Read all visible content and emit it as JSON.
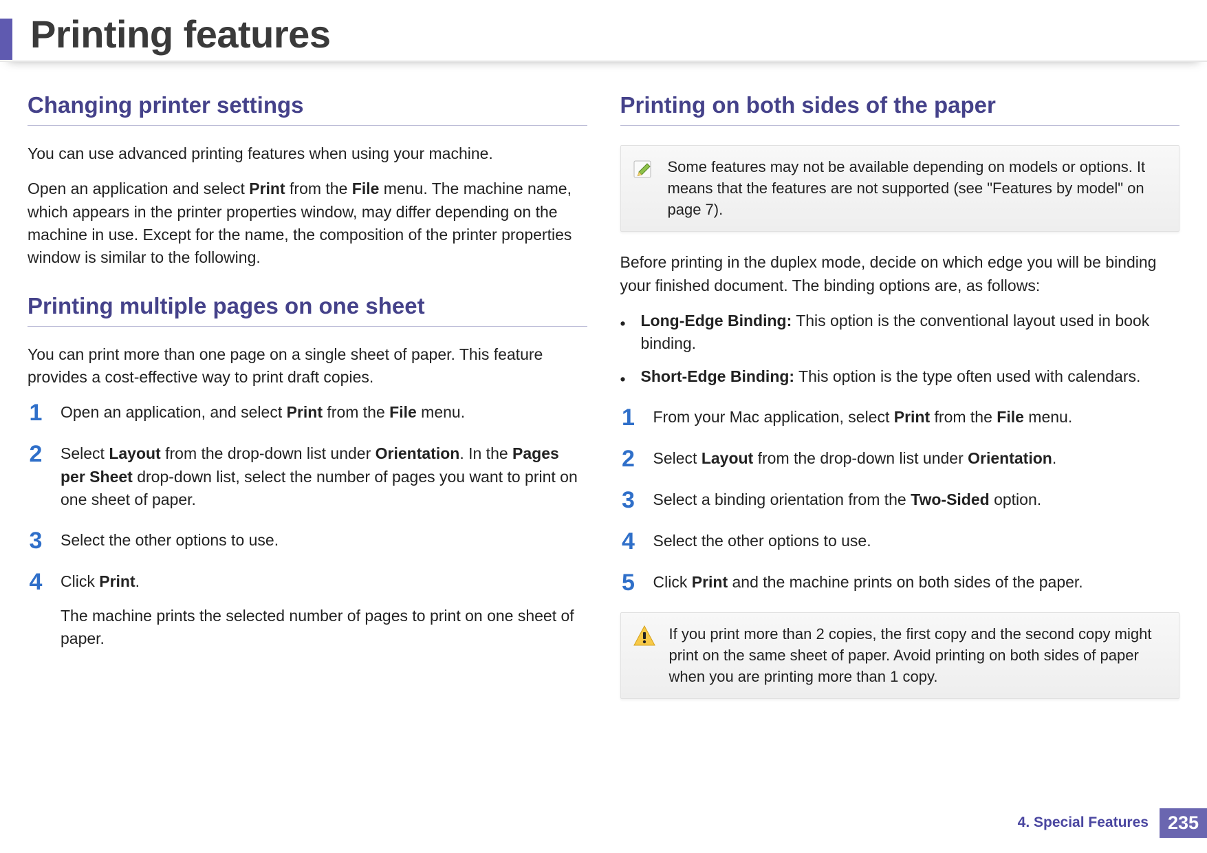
{
  "title": "Printing features",
  "left": {
    "h1": "Changing printer settings",
    "p1": "You can use advanced printing features when using your machine.",
    "p2_pre": "Open an application and select ",
    "p2_b1": "Print",
    "p2_mid1": " from the ",
    "p2_b2": "File",
    "p2_post": " menu. The machine name, which appears in the printer properties window, may differ depending on the machine in use. Except for the name, the composition of the printer properties window is similar to the following.",
    "h2": "Printing multiple pages on one sheet",
    "p3": "You can print more than one page on a single sheet of paper. This feature provides a cost-effective way to print draft copies.",
    "steps": {
      "n1": "1",
      "s1_pre": "Open an application, and select ",
      "s1_b1": "Print",
      "s1_mid": " from the ",
      "s1_b2": "File",
      "s1_post": " menu.",
      "n2": "2",
      "s2_pre": "Select ",
      "s2_b1": "Layout",
      "s2_mid1": " from the drop-down list under ",
      "s2_b2": "Orientation",
      "s2_mid2": ". In the ",
      "s2_b3": "Pages per Sheet",
      "s2_post": " drop-down list, select the number of pages you want to print on one sheet of paper.",
      "n3": "3",
      "s3": "Select the other options to use.",
      "n4": "4",
      "s4_pre": "Click ",
      "s4_b1": "Print",
      "s4_post": ".",
      "s4_sub": "The machine prints the selected number of pages to print on one sheet of paper."
    }
  },
  "right": {
    "h1": "Printing on both sides of the paper",
    "note1": "Some features may not be available depending on models or options. It means that the features are not supported (see \"Features by model\" on page 7).",
    "p1": "Before printing in the duplex mode, decide on which edge you will be binding your finished document. The binding options are, as follows:",
    "bullet1_b": "Long-Edge Binding:",
    "bullet1_t": " This option is the conventional layout used in book binding.",
    "bullet2_b": "Short-Edge Binding:",
    "bullet2_t": " This option is the type often used with calendars.",
    "steps": {
      "n1": "1",
      "s1_pre": "From your Mac application, select ",
      "s1_b1": "Print",
      "s1_mid": " from the ",
      "s1_b2": "File",
      "s1_post": " menu.",
      "n2": "2",
      "s2_pre": "Select ",
      "s2_b1": "Layout",
      "s2_mid": " from the drop-down list under ",
      "s2_b2": "Orientation",
      "s2_post": ".",
      "n3": "3",
      "s3_pre": "Select a binding orientation from the ",
      "s3_b1": "Two-Sided",
      "s3_post": " option.",
      "n4": "4",
      "s4": "Select the other options to use.",
      "n5": "5",
      "s5_pre": "Click ",
      "s5_b1": "Print",
      "s5_post": " and the machine prints on both sides of the paper."
    },
    "note2": "If you print more than 2 copies, the first copy and the second copy might print on the same sheet of paper. Avoid printing on both sides of paper when you are printing more than 1 copy."
  },
  "footer": {
    "chapter": "4.  Special Features",
    "page": "235"
  }
}
